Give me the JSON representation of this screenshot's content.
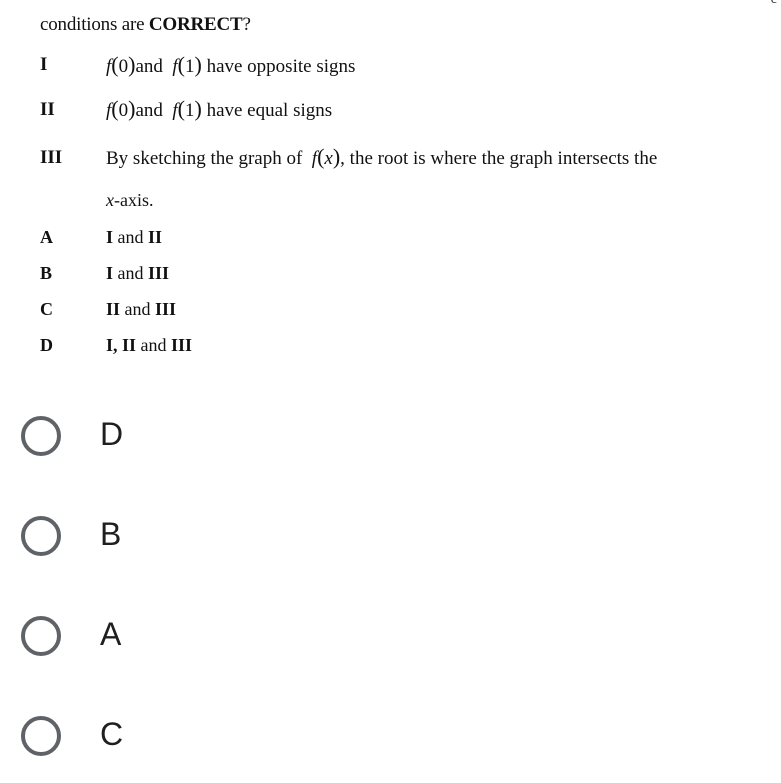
{
  "question": {
    "prompt_prefix": "conditions are ",
    "prompt_emphasis": "CORRECT",
    "prompt_suffix": "?",
    "statements": [
      {
        "numeral": "I",
        "f": "f",
        "arg0": "0",
        "and": "and",
        "arg1": "1",
        "text": "have opposite signs"
      },
      {
        "numeral": "II",
        "f": "f",
        "arg0": "0",
        "and": "and",
        "arg1": "1",
        "text": "have equal signs"
      },
      {
        "numeral": "III",
        "text_before": "By sketching the graph of",
        "f": "f",
        "var": "x",
        "text_after": ", the root is where the graph intersects the",
        "continuation_var": "x",
        "continuation_text": "-axis."
      }
    ],
    "options": [
      {
        "letter": "A",
        "parts": [
          "I",
          " and ",
          "II"
        ]
      },
      {
        "letter": "B",
        "parts": [
          "I",
          " and ",
          "III"
        ]
      },
      {
        "letter": "C",
        "parts": [
          "II",
          " and ",
          "III"
        ]
      },
      {
        "letter": "D",
        "parts": [
          "I, II",
          " and ",
          "III"
        ]
      }
    ]
  },
  "answer_choices": [
    {
      "label": "D",
      "selected": false
    },
    {
      "label": "B",
      "selected": false
    },
    {
      "label": "A",
      "selected": false
    },
    {
      "label": "C",
      "selected": false
    }
  ],
  "colors": {
    "radio_border": "#5f6368",
    "choice_text": "#1f1f1f",
    "question_text": "#111111"
  }
}
